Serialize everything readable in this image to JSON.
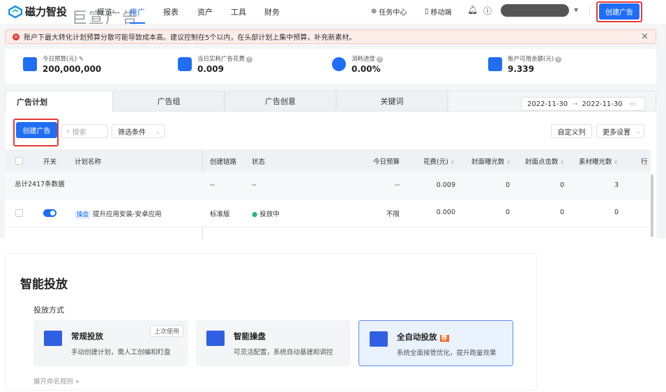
{
  "header": {
    "logo": "磁力智投",
    "brand_overlay": "巨宣广告",
    "nav": [
      "概览",
      "推广",
      "报表",
      "资产",
      "工具",
      "财务"
    ],
    "active_nav": "推广",
    "task_center": "任务中心",
    "mobile": "移动端",
    "create_ad": "创建广告"
  },
  "alert": {
    "text": "账户下最大转化计划预算分散可能导致成本高。建议控制在5个以内，在头部计划上集中预算，补充新素材。"
  },
  "stats": [
    {
      "label": "今日预算(元)",
      "value": "200,000,000"
    },
    {
      "label": "当日实耗广告花费",
      "value": "0.009"
    },
    {
      "label": "消耗进度",
      "value": "0.00%"
    },
    {
      "label": "账户可用余额(元)",
      "value": "9.339"
    }
  ],
  "tabs": [
    "广告计划",
    "广告组",
    "广告创意",
    "关键词"
  ],
  "date_range": {
    "start": "2022-11-30",
    "end": "2022-11-30",
    "sep": "→"
  },
  "toolbar": {
    "create": "创建广告",
    "search_placeholder": "搜索",
    "filter": "筛选条件",
    "custom_cols": "自定义列",
    "more_settings": "更多设置"
  },
  "table": {
    "headers": [
      "开关",
      "计划名称",
      "创建链路",
      "状态",
      "今日预算",
      "花费(元)",
      "封面曝光数",
      "封面点击数",
      "素材曝光数",
      "行"
    ],
    "summary": {
      "label": "总计2417条数据",
      "chain": "--",
      "status": "--",
      "budget": "--",
      "cost": "0.009",
      "cover_imp": "0",
      "cover_click": "0",
      "material_imp": "3"
    },
    "rows": [
      {
        "tag": "操盘",
        "name": "提升应用安装-安卓应用",
        "chain": "标准版",
        "status": "投放中",
        "budget": "不限",
        "cost": "0.000",
        "cover_imp": "0",
        "cover_click": "0",
        "material_imp": "0"
      }
    ]
  },
  "smart": {
    "title": "智能投放",
    "subtitle": "投放方式",
    "expand": "展开命名规则",
    "cards": [
      {
        "title": "常规投放",
        "desc": "手动创建计划，需人工创编和盯盘",
        "badge": "上次使用"
      },
      {
        "title": "智能操盘",
        "desc": "可灵活配置，系统自动基建和调控"
      },
      {
        "title": "全自动投放",
        "desc": "系统全面接管优化，提升跑量效果",
        "badge": "荐"
      }
    ]
  },
  "colors": {
    "primary": "#1f6ef5",
    "error": "#e53935",
    "recommend": "#f26522"
  }
}
